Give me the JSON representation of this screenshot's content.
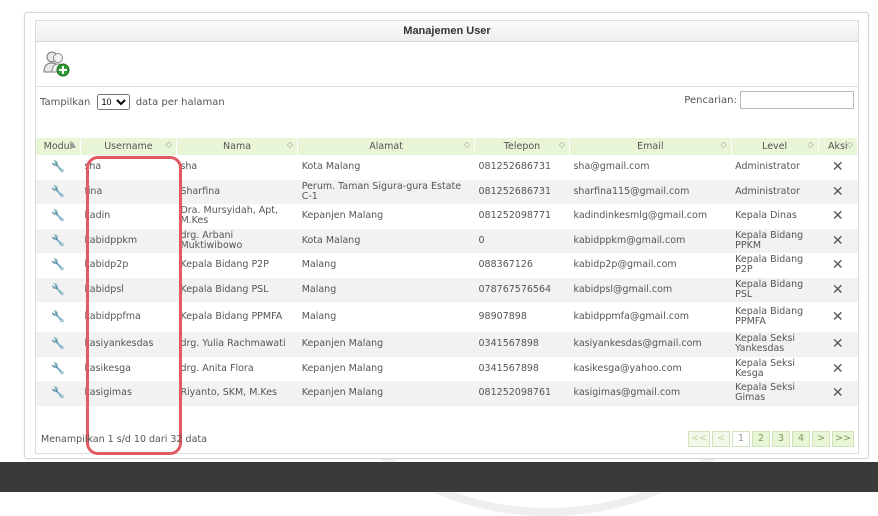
{
  "panel": {
    "title": "Manajemen User"
  },
  "toolbar": {
    "add_user_icon": "add-user-icon"
  },
  "controls": {
    "show_prefix": "Tampilkan",
    "show_value": "10",
    "show_suffix": "data per halaman",
    "search_label": "Pencarian:",
    "search_value": ""
  },
  "table": {
    "headers": [
      "Modul",
      "Username",
      "Nama",
      "Alamat",
      "Telepon",
      "Email",
      "Level",
      "Aksi"
    ],
    "rows": [
      {
        "username": "sha",
        "nama": "sha",
        "alamat": "Kota Malang",
        "telepon": "081252686731",
        "email": "sha@gmail.com",
        "level": "Administrator"
      },
      {
        "username": "fina",
        "nama": "Sharfina",
        "alamat": "Perum. Taman Sigura-gura Estate C-1",
        "telepon": "081252686731",
        "email": "sharfina115@gmail.com",
        "level": "Administrator"
      },
      {
        "username": "kadin",
        "nama": "Dra. Mursyidah, Apt, M.Kes",
        "alamat": "Kepanjen Malang",
        "telepon": "081252098771",
        "email": "kadindinkesmlg@gmail.com",
        "level": "Kepala Dinas"
      },
      {
        "username": "kabidppkm",
        "nama": "drg. Arbani Muktiwibowo",
        "alamat": "Kota Malang",
        "telepon": "0",
        "email": "kabidppkm@gmail.com",
        "level": "Kepala Bidang PPKM"
      },
      {
        "username": "kabidp2p",
        "nama": "Kepala Bidang P2P",
        "alamat": "Malang",
        "telepon": "088367126",
        "email": "kabidp2p@gmail.com",
        "level": "Kepala Bidang P2P"
      },
      {
        "username": "kabidpsl",
        "nama": "Kepala Bidang PSL",
        "alamat": "Malang",
        "telepon": "078767576564",
        "email": "kabidpsl@gmail.com",
        "level": "Kepala Bidang PSL"
      },
      {
        "username": "kabidppfma",
        "nama": "Kepala Bidang PPMFA",
        "alamat": "Malang",
        "telepon": "98907898",
        "email": "kabidppmfa@gmail.com",
        "level": "Kepala Bidang PPMFA"
      },
      {
        "username": "kasiyankesdas",
        "nama": "drg. Yulia Rachmawati",
        "alamat": "Kepanjen Malang",
        "telepon": "0341567898",
        "email": "kasiyankesdas@gmail.com",
        "level": "Kepala Seksi Yankesdas"
      },
      {
        "username": "kasikesga",
        "nama": "drg. Anita Flora",
        "alamat": "Kepanjen Malang",
        "telepon": "0341567898",
        "email": "kasikesga@yahoo.com",
        "level": "Kepala Seksi Kesga"
      },
      {
        "username": "kasigimas",
        "nama": "Riyanto, SKM, M.Kes",
        "alamat": "Kepanjen Malang",
        "telepon": "081252098761",
        "email": "kasigimas@gmail.com",
        "level": "Kepala Seksi Gimas"
      }
    ]
  },
  "footer": {
    "info": "Menampilkan 1 s/d 10 dari 32 data",
    "pager": [
      "<<",
      "<",
      "1",
      "2",
      "3",
      "4",
      ">",
      ">>"
    ]
  },
  "colors": {
    "header_bg": "#e8f5d6",
    "link": "#4a8ed0",
    "highlight": "#e25a62",
    "band": "#3a3a3a"
  }
}
